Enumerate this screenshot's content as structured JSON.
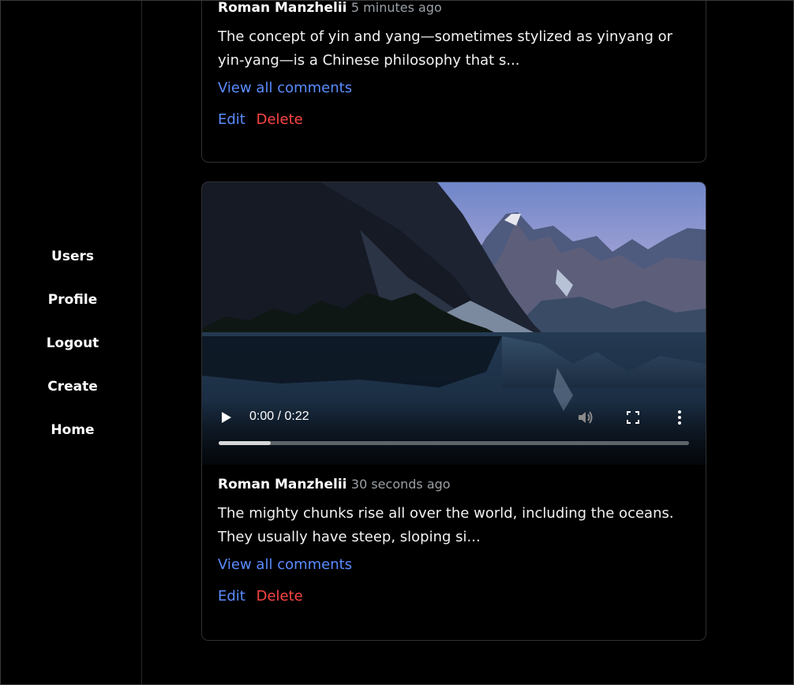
{
  "sidebar": {
    "items": [
      {
        "label": "Users"
      },
      {
        "label": "Profile"
      },
      {
        "label": "Logout"
      },
      {
        "label": "Create"
      },
      {
        "label": "Home"
      }
    ]
  },
  "posts": [
    {
      "author": "Roman Manzhelii",
      "time": "5 minutes ago",
      "text_line1": "The concept of yin and yang—sometimes stylized as yinyang or",
      "text_line2": "yin-yang—is a Chinese philosophy that s...",
      "view_all": "View all comments",
      "edit": "Edit",
      "delete": "Delete"
    },
    {
      "author": "Roman Manzhelii",
      "time": "30 seconds ago",
      "text_line1": "The mighty chunks rise all over the world, including the oceans.",
      "text_line2": "They usually have steep, sloping si...",
      "view_all": "View all comments",
      "edit": "Edit",
      "delete": "Delete",
      "video": {
        "timecode": "0:00 / 0:22",
        "progress": 0.11
      }
    }
  ],
  "colors": {
    "link": "#5b8cff",
    "danger": "#ff4545",
    "muted": "#9aa0a6"
  }
}
